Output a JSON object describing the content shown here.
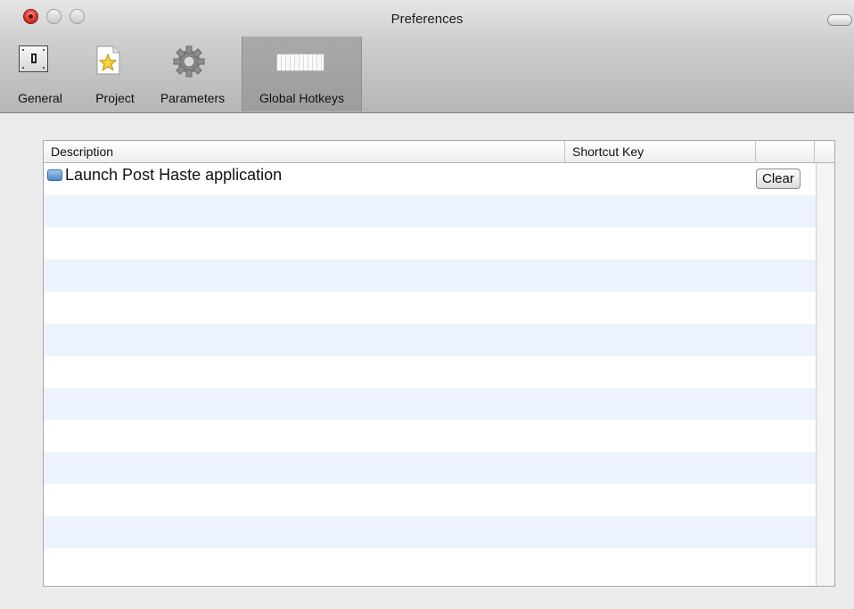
{
  "window": {
    "title": "Preferences"
  },
  "toolbar": {
    "items": [
      {
        "label": "General",
        "icon": "switch-icon",
        "selected": false
      },
      {
        "label": "Project",
        "icon": "star-document-icon",
        "selected": false
      },
      {
        "label": "Parameters",
        "icon": "gear-icon",
        "selected": false
      },
      {
        "label": "Global Hotkeys",
        "icon": "keyboard-icon",
        "selected": true
      }
    ]
  },
  "table": {
    "columns": [
      "Description",
      "Shortcut Key",
      ""
    ],
    "rows": [
      {
        "description": "Launch Post Haste application",
        "icon": "app-icon",
        "shortcut": "",
        "action": "Clear"
      }
    ]
  },
  "colors": {
    "row_alt": "#edf3fe",
    "selected_toolbar": "#a3a3a3"
  }
}
